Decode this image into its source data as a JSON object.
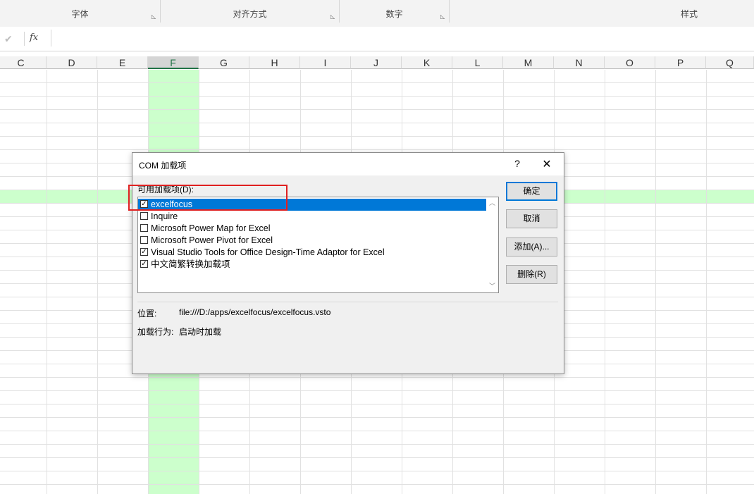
{
  "ribbon": {
    "groups": [
      {
        "label": "字体",
        "launcher": "dialog-launcher-icon"
      },
      {
        "label": "对齐方式",
        "launcher": "dialog-launcher-icon"
      },
      {
        "label": "数字",
        "launcher": "dialog-launcher-icon"
      },
      {
        "label": "样式"
      }
    ]
  },
  "formula_bar": {
    "check_icon": "✔",
    "fx_label": "fx",
    "value": ""
  },
  "columns": [
    "C",
    "D",
    "E",
    "F",
    "G",
    "H",
    "I",
    "J",
    "K",
    "L",
    "M",
    "N",
    "O",
    "P",
    "Q"
  ],
  "selected_column": "F",
  "highlight_color": "#ccffcc",
  "dialog": {
    "title": "COM 加载项",
    "help": "?",
    "close": "✕",
    "list_label": "可用加载项(D):",
    "items": [
      {
        "label": "excelfocus",
        "checked": true,
        "selected": true
      },
      {
        "label": "Inquire",
        "checked": false,
        "selected": false
      },
      {
        "label": "Microsoft Power Map for Excel",
        "checked": false,
        "selected": false
      },
      {
        "label": "Microsoft Power Pivot for Excel",
        "checked": false,
        "selected": false
      },
      {
        "label": "Visual Studio Tools for Office Design-Time Adaptor for Excel",
        "checked": true,
        "selected": false
      },
      {
        "label": "中文简繁转换加载项",
        "checked": true,
        "selected": false
      }
    ],
    "buttons": {
      "ok": "确定",
      "cancel": "取消",
      "add": "添加(A)...",
      "remove": "删除(R)"
    },
    "location_label": "位置:",
    "location_value": "file:///D:/apps/excelfocus/excelfocus.vsto",
    "load_behavior_label": "加载行为:",
    "load_behavior_value": "启动时加载",
    "accent_color": "#0078d7",
    "annotation_color": "#e02020"
  }
}
